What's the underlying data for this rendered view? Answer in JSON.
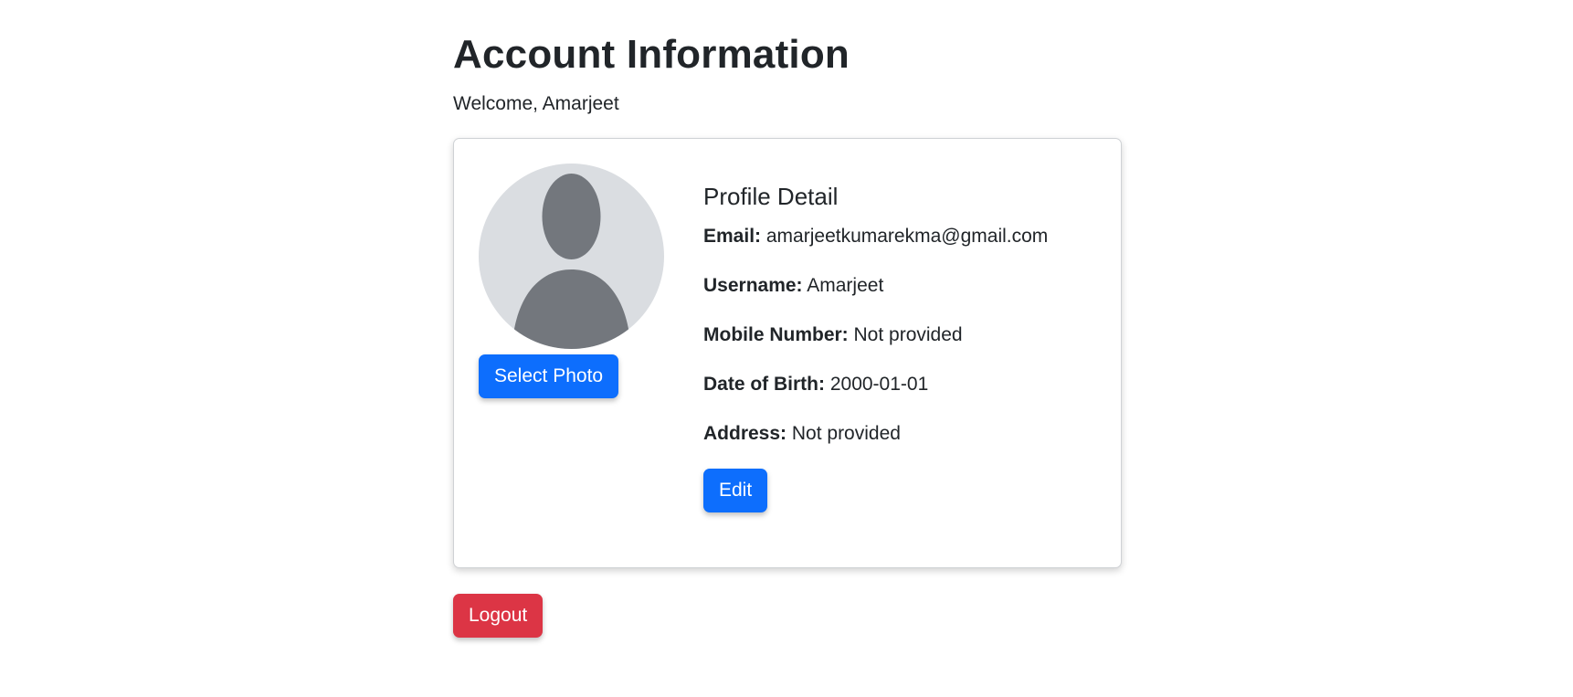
{
  "header": {
    "title": "Account Information",
    "welcome": "Welcome, Amarjeet"
  },
  "profile": {
    "avatar_icon": "user-silhouette-icon",
    "select_photo_label": "Select Photo",
    "section_title": "Profile Detail",
    "fields": [
      {
        "label": "Email:",
        "value": "amarjeetkumarekma@gmail.com"
      },
      {
        "label": "Username:",
        "value": "Amarjeet"
      },
      {
        "label": "Mobile Number:",
        "value": "Not provided"
      },
      {
        "label": "Date of Birth:",
        "value": "2000-01-01"
      },
      {
        "label": "Address:",
        "value": "Not provided"
      }
    ],
    "edit_label": "Edit"
  },
  "actions": {
    "logout_label": "Logout"
  },
  "colors": {
    "primary": "#0d6efd",
    "danger": "#dc3545",
    "avatar_bg": "#dadde1",
    "avatar_fg": "#73777d",
    "text": "#212529"
  }
}
